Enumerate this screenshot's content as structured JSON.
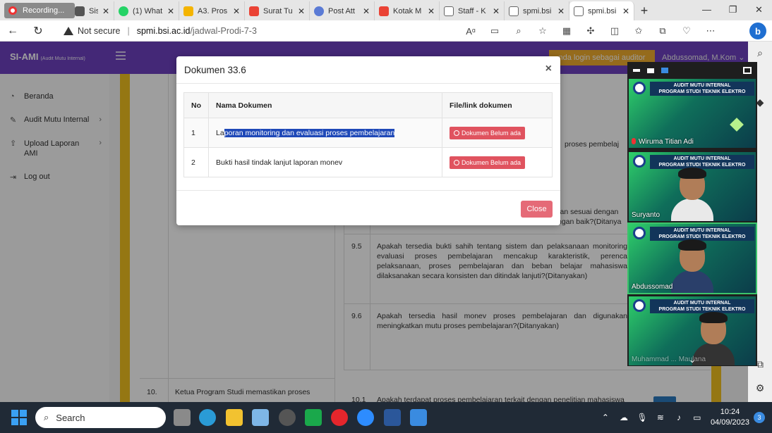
{
  "browser": {
    "recording_label": "Recording...",
    "tabs": [
      {
        "label": "Sistem In",
        "color": "#555555"
      },
      {
        "label": "(1) What",
        "color": "#25d366"
      },
      {
        "label": "A3. Pros",
        "color": "#f4b400"
      },
      {
        "label": "Surat Tu",
        "color": "#ea4335"
      },
      {
        "label": "Post Att",
        "color": "#5b7bd5"
      },
      {
        "label": "Kotak M",
        "color": "#ea4335"
      },
      {
        "label": "Staff - K",
        "color": "#666666"
      },
      {
        "label": "spmi.bsi",
        "color": "#666666"
      },
      {
        "label": "spmi.bsi",
        "color": "#666666"
      }
    ],
    "security": "Not secure",
    "url_domain": "spmi.bsi.ac.id",
    "url_path": "/jadwal-Prodi-7-3"
  },
  "app": {
    "brand": "SI-AMI",
    "brand_sub": "(Audit Mutu Internal)",
    "login_badge": "nda login sebagai auditor",
    "user": "Abdussomad, M.Kom",
    "sidebar": [
      {
        "label": "Beranda",
        "icon": "gauge-icon"
      },
      {
        "label": "Audit Mutu Internal",
        "icon": "edit-icon"
      },
      {
        "label": "Upload Laporan AMI",
        "icon": "upload-icon"
      },
      {
        "label": "Log out",
        "icon": "logout-icon"
      }
    ],
    "content": {
      "row1_text": "proses pembelaj",
      "row2_text": "ran sesuai dengan\nngan baik?(Ditanya",
      "item_95_no": "9.5",
      "item_95_text": "Apakah tersedia bukti sahih tentang sistem dan pelaksanaan monitoring evaluasi proses pembelajaran mencakup karakteristik, perenca pelaksanaan, proses pembelajaran dan beban belajar mahasiswa dilaksanakan secara konsisten dan ditindak lanjuti?(Ditanyakan)",
      "item_96_no": "9.6",
      "item_96_text": "Apakah tersedia hasil monev proses pembelajaran dan digunakan meningkatkan mutu proses pembelajaran?(Ditanyakan)",
      "row10_no": "10.",
      "row10_text": "Ketua Program Studi memastikan proses",
      "row101_no": "10.1",
      "row101_text": "Apakah terdapat proses pembelajaran terkait dengan penelitian mahasiswa"
    }
  },
  "modal": {
    "title": "Dokumen 33.6",
    "close_x": "×",
    "headers": {
      "no": "No",
      "nama": "Nama Dokumen",
      "file": "File/link dokumen"
    },
    "rows": [
      {
        "no": "1",
        "nama_pre": "La",
        "nama_hl": "poran monitoring dan evaluasi proses pembelajaran",
        "status": "Dokumen Belum ada"
      },
      {
        "no": "2",
        "nama": "Bukti hasil tindak lanjut laporan monev",
        "status": "Dokumen Belum ada"
      }
    ],
    "close_label": "Close"
  },
  "video": {
    "banner_line1": "AUDIT MUTU INTERNAL",
    "banner_line2": "PROGRAM STUDI TEKNIK ELEKTRO",
    "participants": [
      "Wiruma Titian Adi",
      "Suryanto",
      "Abdussomad",
      "Muhammad ... Maulana"
    ]
  },
  "taskbar": {
    "search": "Search",
    "time": "10:24",
    "date": "04/09/2023",
    "notifications": "3"
  }
}
